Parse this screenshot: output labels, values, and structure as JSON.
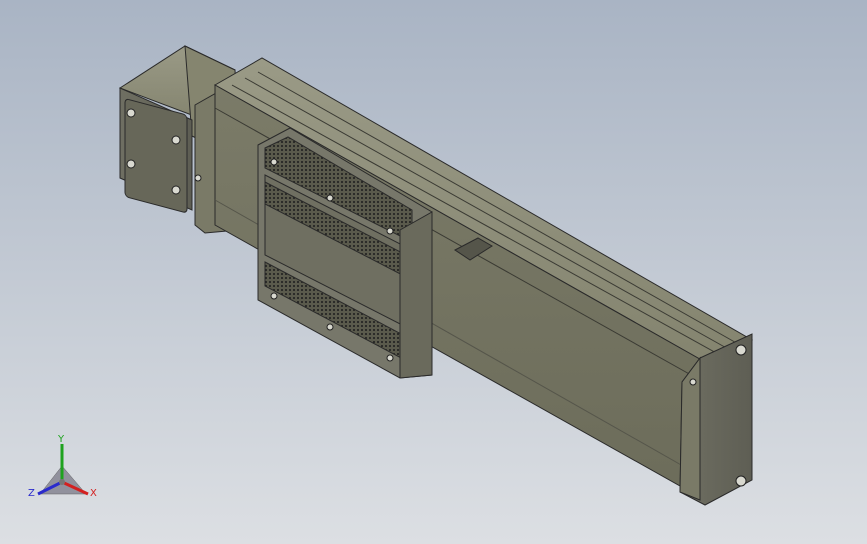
{
  "viewport": {
    "background_top": "#a9b4c4",
    "background_bottom": "#dcdfe3",
    "model_color": "#7c7c6a"
  },
  "triad": {
    "x_label": "X",
    "y_label": "Y",
    "z_label": "Z",
    "x_color": "#d32020",
    "y_color": "#1fa21f",
    "z_color": "#2a2acc"
  }
}
